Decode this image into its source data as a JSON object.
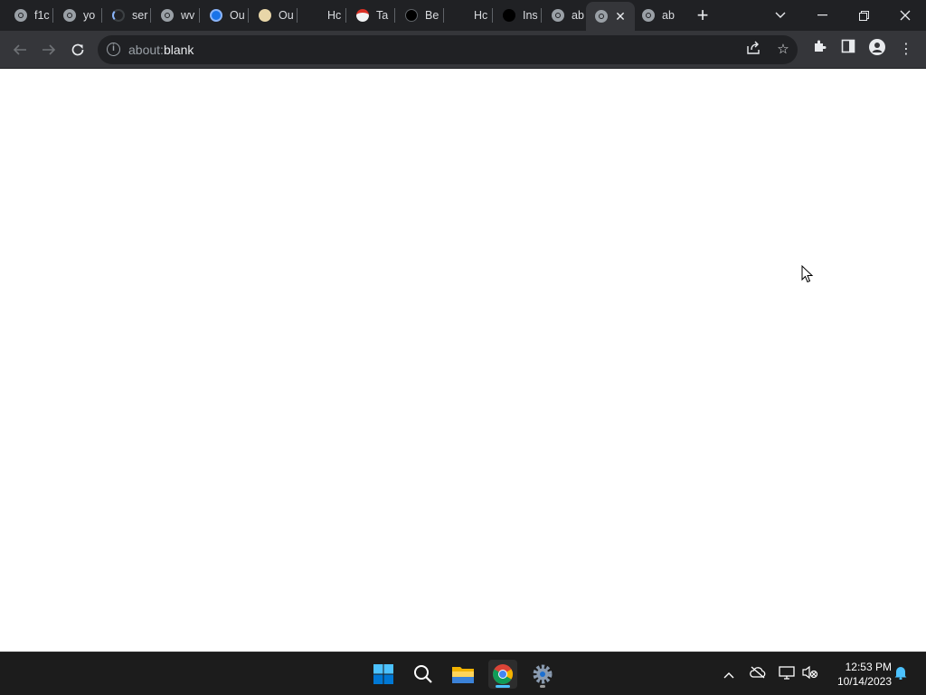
{
  "tabs": [
    {
      "title": "f1c",
      "icon": "globe-icon"
    },
    {
      "title": "yo",
      "icon": "globe-icon"
    },
    {
      "title": "ser",
      "icon": "loading-spinner-icon"
    },
    {
      "title": "wv",
      "icon": "globe-icon"
    },
    {
      "title": "Ou",
      "icon": "chat-app-icon"
    },
    {
      "title": "Ou",
      "icon": "image-icon"
    },
    {
      "title": "Hc",
      "icon": "blank-icon"
    },
    {
      "title": "Ta",
      "icon": "calendar-icon"
    },
    {
      "title": "Be",
      "icon": "shield-icon"
    },
    {
      "title": "Hc",
      "icon": "blank-icon"
    },
    {
      "title": "Ins",
      "icon": "dark-logo-icon"
    },
    {
      "title": "ab",
      "icon": "globe-icon"
    },
    {
      "title": "",
      "icon": "globe-icon",
      "active": true
    },
    {
      "title": "ab",
      "icon": "globe-icon"
    }
  ],
  "address_bar": {
    "scheme": "about:",
    "path": "blank"
  },
  "taskbar": {
    "apps": [
      "start-icon",
      "search-icon",
      "file-explorer-icon",
      "chrome-icon",
      "settings-icon"
    ],
    "clock": {
      "time": "12:53 PM",
      "date": "10/14/2023"
    }
  },
  "colors": {
    "tabstrip": "#202124",
    "toolbar": "#35363a",
    "taskbar": "#1c1c1c",
    "accent": "#4cc2ff"
  }
}
